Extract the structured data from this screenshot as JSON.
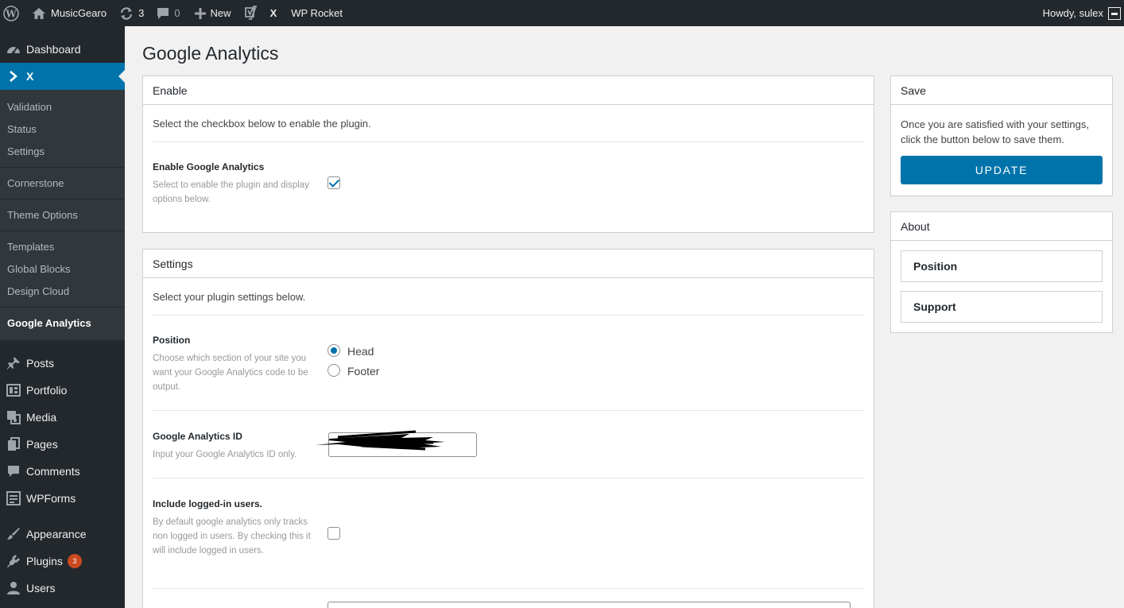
{
  "adminbar": {
    "site_name": "MusicGearo",
    "updates_count": "3",
    "comments_count": "0",
    "new_label": "New",
    "x_label": "X",
    "rocket_label": "WP Rocket",
    "howdy": "Howdy, sulex"
  },
  "sidebar": {
    "dashboard": "Dashboard",
    "x": "X",
    "x_submenu": [
      "Validation",
      "Status",
      "Settings",
      "Cornerstone",
      "Theme Options",
      "Templates",
      "Global Blocks",
      "Design Cloud",
      "Google Analytics"
    ],
    "posts": "Posts",
    "portfolio": "Portfolio",
    "media": "Media",
    "pages": "Pages",
    "comments": "Comments",
    "wpforms": "WPForms",
    "appearance": "Appearance",
    "plugins": "Plugins",
    "plugins_badge": "3",
    "users": "Users"
  },
  "page": {
    "title": "Google Analytics"
  },
  "enable_box": {
    "title": "Enable",
    "description": "Select the checkbox below to enable the plugin.",
    "field_label": "Enable Google Analytics",
    "field_help": "Select to enable the plugin and display options below.",
    "checked": true
  },
  "settings_box": {
    "title": "Settings",
    "description": "Select your plugin settings below.",
    "position_label": "Position",
    "position_help": "Choose which section of your site you want your Google Analytics code to be output.",
    "position_options": [
      "Head",
      "Footer"
    ],
    "position_selected": "Head",
    "ga_id_label": "Google Analytics ID",
    "ga_id_help": "Input your Google Analytics ID only.",
    "logged_in_label": "Include logged-in users.",
    "logged_in_help": "By default google analytics only tracks non logged in users. By checking this it will include logged in users.",
    "logged_in_checked": false
  },
  "save_box": {
    "title": "Save",
    "text": "Once you are satisfied with your settings, click the button below to save them.",
    "button": "UPDATE"
  },
  "about_box": {
    "title": "About",
    "items": [
      "Position",
      "Support"
    ]
  },
  "colors": {
    "accent": "#0073aa",
    "adminbar": "#23282d",
    "badge": "#ca4a1f"
  }
}
